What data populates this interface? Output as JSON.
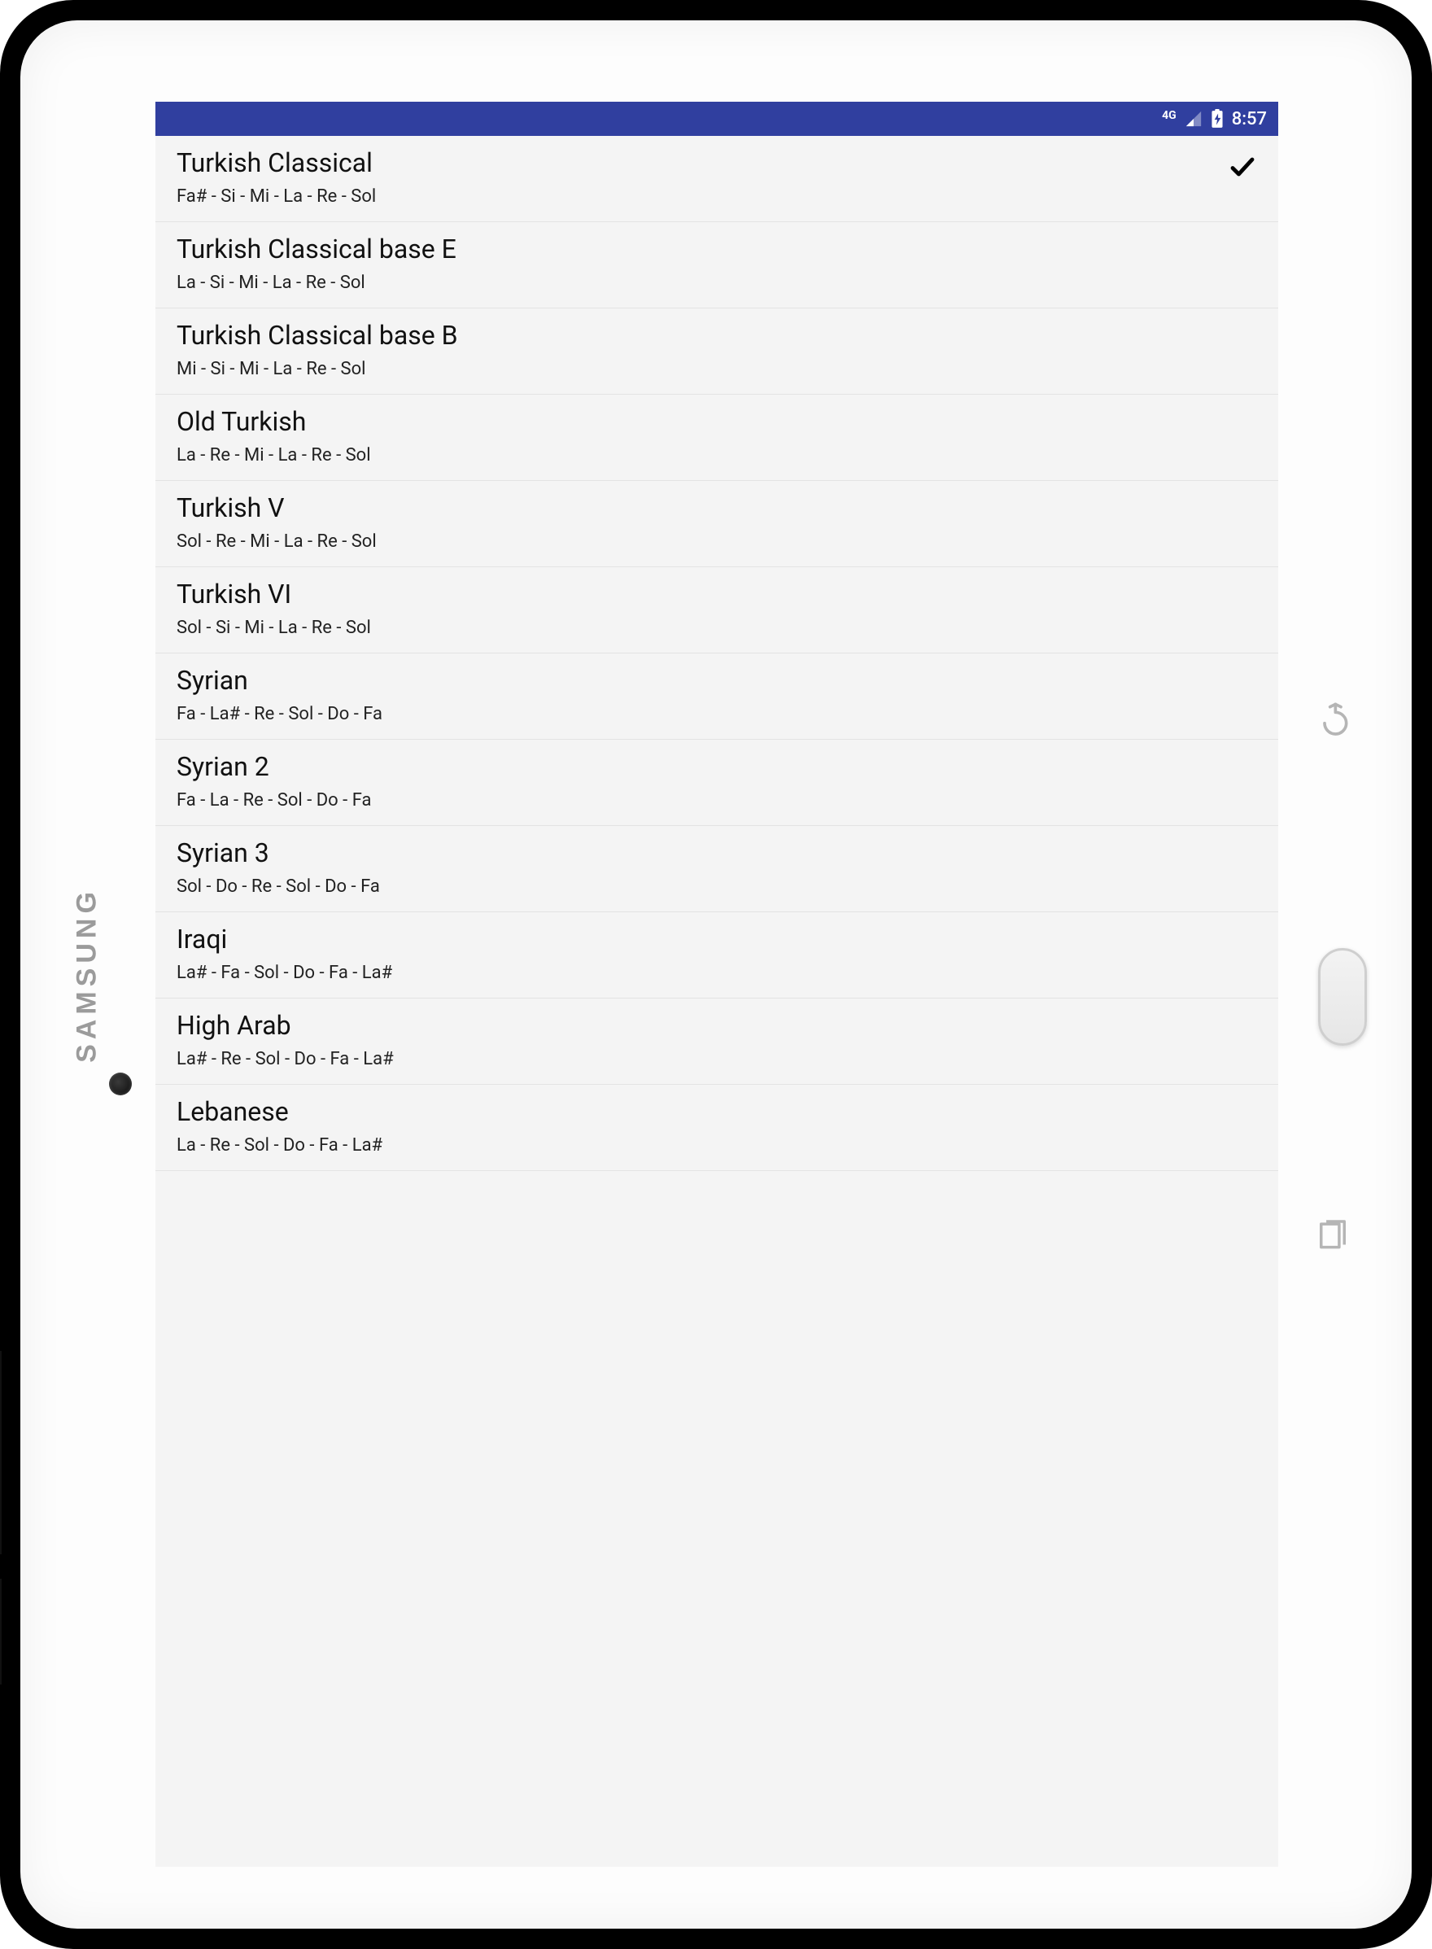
{
  "device": {
    "brand": "SAMSUNG"
  },
  "statusbar": {
    "network_label": "4G",
    "time": "8:57"
  },
  "list": {
    "items": [
      {
        "title": "Turkish Classical",
        "subtitle": "Fa# - Si - Mi - La - Re - Sol",
        "selected": true
      },
      {
        "title": "Turkish Classical base E",
        "subtitle": "La - Si - Mi - La - Re - Sol",
        "selected": false
      },
      {
        "title": "Turkish Classical base B",
        "subtitle": "Mi - Si - Mi - La - Re - Sol",
        "selected": false
      },
      {
        "title": "Old Turkish",
        "subtitle": "La - Re - Mi - La - Re - Sol",
        "selected": false
      },
      {
        "title": "Turkish V",
        "subtitle": "Sol - Re - Mi - La - Re - Sol",
        "selected": false
      },
      {
        "title": "Turkish VI",
        "subtitle": "Sol - Si - Mi - La - Re - Sol",
        "selected": false
      },
      {
        "title": "Syrian",
        "subtitle": "Fa - La# - Re - Sol - Do - Fa",
        "selected": false
      },
      {
        "title": "Syrian 2",
        "subtitle": "Fa - La - Re - Sol - Do - Fa",
        "selected": false
      },
      {
        "title": "Syrian 3",
        "subtitle": "Sol - Do - Re - Sol - Do - Fa",
        "selected": false
      },
      {
        "title": "Iraqi",
        "subtitle": "La# - Fa - Sol - Do - Fa - La#",
        "selected": false
      },
      {
        "title": "High Arab",
        "subtitle": "La# - Re - Sol - Do - Fa - La#",
        "selected": false
      },
      {
        "title": "Lebanese",
        "subtitle": "La - Re - Sol - Do - Fa - La#",
        "selected": false
      }
    ]
  }
}
